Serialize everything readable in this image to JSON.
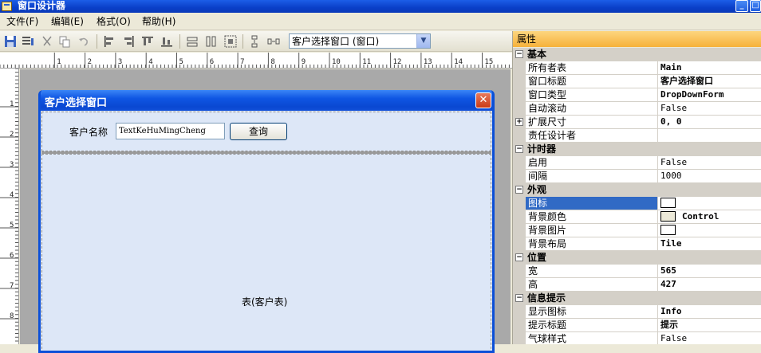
{
  "window": {
    "title": "窗口设计器",
    "min_glyph": "_",
    "max_glyph": "□"
  },
  "menu": [
    {
      "label": "文件(F)"
    },
    {
      "label": "编辑(E)"
    },
    {
      "label": "格式(O)"
    },
    {
      "label": "帮助(H)"
    }
  ],
  "toolbar": {
    "buttons": [
      "save-icon",
      "properties-icon",
      "cut-icon",
      "copy-icon",
      "undo-icon",
      "align-left-icon",
      "align-right-icon",
      "align-top-icon",
      "align-bottom-icon",
      "same-width-icon",
      "same-height-icon",
      "same-size-icon",
      "vertical-spacing-icon",
      "horizontal-spacing-icon"
    ],
    "combo_value": "客户选择窗口 (窗口)",
    "combo_arrow": "▼"
  },
  "ruler": {
    "h_numbers": [
      "1",
      "2",
      "3",
      "4",
      "5",
      "6",
      "7",
      "8",
      "9",
      "10",
      "11",
      "12",
      "13",
      "14",
      "15"
    ],
    "v_numbers": [
      "1",
      "2",
      "3",
      "4",
      "5",
      "6",
      "7",
      "8"
    ]
  },
  "form": {
    "caption": "客户选择窗口",
    "close_glyph": "✕",
    "customer_label": "客户名称",
    "customer_input_value": "TextKeHuMingCheng",
    "query_button": "查询",
    "table_label": "表(客户表)"
  },
  "props": {
    "header": "属性",
    "expand_glyph": "+",
    "collapse_glyph": "−",
    "categories": {
      "basic": "基本",
      "timer": "计时器",
      "appearance": "外观",
      "position": "位置",
      "tip": "信息提示"
    },
    "rows": {
      "owner_table": {
        "name": "所有者表",
        "value": "Main"
      },
      "window_title": {
        "name": "窗口标题",
        "value": "客户选择窗口"
      },
      "window_type": {
        "name": "窗口类型",
        "value": "DropDownForm"
      },
      "auto_scroll": {
        "name": "自动滚动",
        "value": "False"
      },
      "extend_size": {
        "name": "扩展尺寸",
        "value": "0, 0"
      },
      "designer": {
        "name": "责任设计者",
        "value": ""
      },
      "enabled": {
        "name": "启用",
        "value": "False"
      },
      "interval": {
        "name": "间隔",
        "value": "1000"
      },
      "icon": {
        "name": "图标",
        "value": ""
      },
      "back_color": {
        "name": "背景颜色",
        "value": "Control"
      },
      "back_image": {
        "name": "背景图片",
        "value": ""
      },
      "back_layout": {
        "name": "背景布局",
        "value": "Tile"
      },
      "width": {
        "name": "宽",
        "value": "565"
      },
      "height": {
        "name": "高",
        "value": "427"
      },
      "show_icon": {
        "name": "显示图标",
        "value": "Info"
      },
      "tip_title": {
        "name": "提示标题",
        "value": "提示"
      },
      "balloon_style": {
        "name": "气球样式",
        "value": "False"
      }
    }
  },
  "colors": {
    "title_bar": "#0a3fc8",
    "form_caption": "#0f56e3",
    "form_body": "#dde7f7",
    "selected_row": "#316ac5",
    "props_header": "#f6b13a",
    "control_swatch": "#ece9d8"
  }
}
